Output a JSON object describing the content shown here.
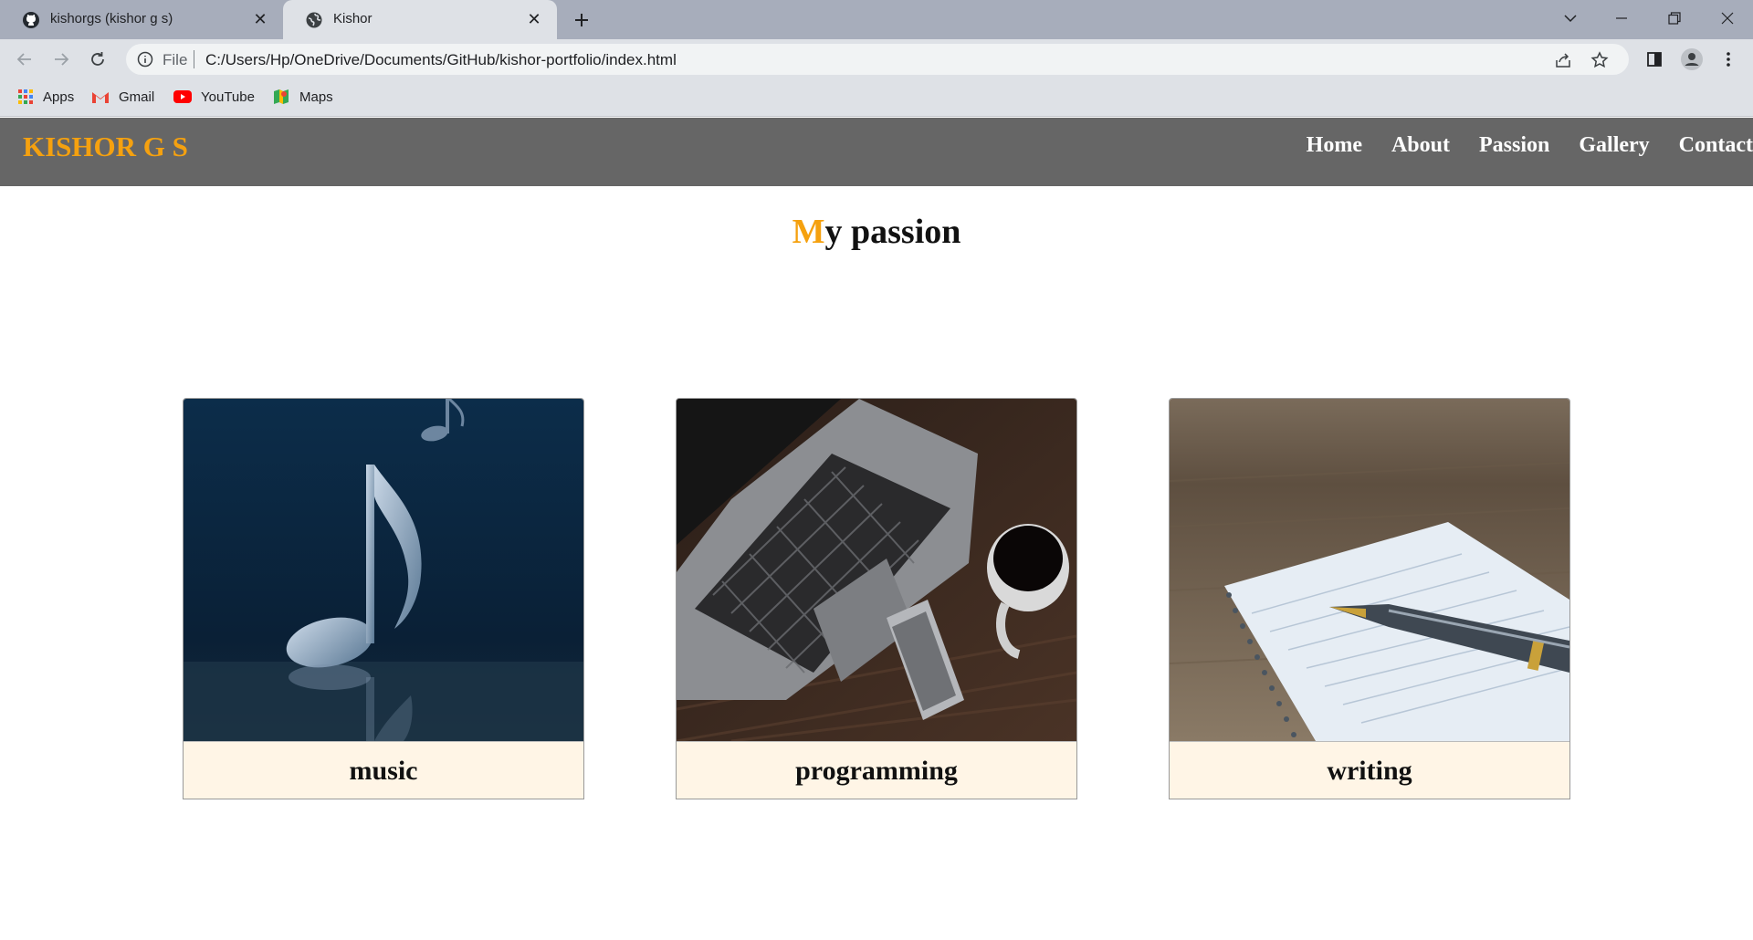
{
  "browser": {
    "tabs": [
      {
        "title": "kishorgs (kishor g s)",
        "active": false,
        "favicon": "github-icon"
      },
      {
        "title": "Kishor",
        "active": true,
        "favicon": "globe-icon"
      }
    ],
    "address": {
      "scheme_label": "File",
      "url": "C:/Users/Hp/OneDrive/Documents/GitHub/kishor-portfolio/index.html"
    },
    "bookmarks": [
      {
        "label": "Apps",
        "icon": "apps-grid-icon"
      },
      {
        "label": "Gmail",
        "icon": "gmail-icon"
      },
      {
        "label": "YouTube",
        "icon": "youtube-icon"
      },
      {
        "label": "Maps",
        "icon": "maps-icon"
      }
    ]
  },
  "site": {
    "logo": "KISHOR G S",
    "nav": [
      "Home",
      "About",
      "Passion",
      "Gallery",
      "Contact"
    ],
    "heading_first": "M",
    "heading_rest": "y passion",
    "cards": [
      {
        "caption": "music",
        "image": "music-note-image"
      },
      {
        "caption": "programming",
        "image": "laptop-coffee-image"
      },
      {
        "caption": "writing",
        "image": "notebook-pen-image"
      }
    ]
  },
  "colors": {
    "accent": "#f5a10f",
    "header_bg": "#666666",
    "caption_bg": "#fff5e6"
  }
}
